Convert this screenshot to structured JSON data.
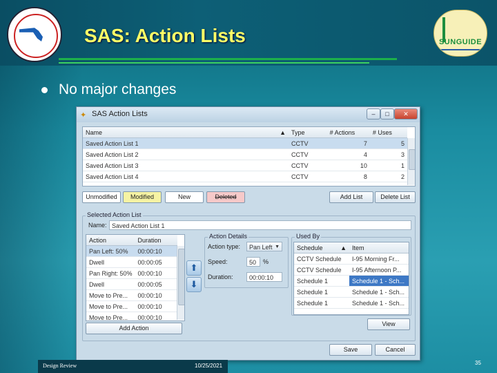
{
  "slide": {
    "title": "SAS: Action Lists",
    "bullet": "No major changes",
    "footer_left": "Design Review",
    "footer_date": "10/25/2021",
    "page_number": "35",
    "logo_text": "SUNGUIDE"
  },
  "window": {
    "title": "SAS Action Lists",
    "list": {
      "columns": [
        "Name",
        "Type",
        "# Actions",
        "# Uses"
      ],
      "rows": [
        [
          "Saved Action List 1",
          "CCTV",
          "7",
          "5"
        ],
        [
          "Saved Action List 2",
          "CCTV",
          "4",
          "3"
        ],
        [
          "Saved Action List 3",
          "CCTV",
          "10",
          "1"
        ],
        [
          "Saved Action List 4",
          "CCTV",
          "8",
          "2"
        ]
      ]
    },
    "legend": {
      "unmodified": "Unmodified",
      "modified": "Modified",
      "new": "New",
      "deleted": "Deleted"
    },
    "buttons": {
      "add_list": "Add List",
      "delete_list": "Delete List",
      "add_action": "Add Action",
      "view": "View",
      "save": "Save",
      "cancel": "Cancel"
    },
    "selected": {
      "group_label": "Selected Action List",
      "name_label": "Name:",
      "name_value": "Saved Action List 1",
      "actions_columns": [
        "Action",
        "Duration"
      ],
      "actions": [
        [
          "Pan Left: 50%",
          "00:00:10"
        ],
        [
          "Dwell",
          "00:00:05"
        ],
        [
          "Pan Right: 50%",
          "00:00:10"
        ],
        [
          "Dwell",
          "00:00:05"
        ],
        [
          "Move to Pre...",
          "00:00:10"
        ],
        [
          "Move to Pre...",
          "00:00:10"
        ],
        [
          "Move to Pre...",
          "00:00:10"
        ]
      ]
    },
    "details": {
      "group_label": "Action Details",
      "type_label": "Action type:",
      "type_value": "Pan Left",
      "speed_label": "Speed:",
      "speed_value": "50",
      "speed_unit": "%",
      "duration_label": "Duration:",
      "duration_value": "00:00:10"
    },
    "used_by": {
      "group_label": "Used By",
      "columns": [
        "Schedule",
        "Item"
      ],
      "rows": [
        [
          "CCTV Schedule",
          "I-95 Morning Fr..."
        ],
        [
          "CCTV Schedule",
          "I-95 Afternoon P..."
        ],
        [
          "Schedule 1",
          "Schedule 1 - Sch..."
        ],
        [
          "Schedule 1",
          "Schedule 1 - Sch..."
        ],
        [
          "Schedule 1",
          "Schedule 1 - Sch..."
        ]
      ]
    }
  },
  "colors": {
    "title_yellow": "#ffff66",
    "modified": "#f6f3a3",
    "new": "#ffffff",
    "deleted": "#f6c9c9",
    "selection": "#3d78c5"
  }
}
